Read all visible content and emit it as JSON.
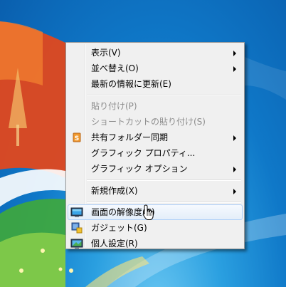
{
  "context_menu": {
    "items": [
      {
        "label": "表示(V)",
        "has_submenu": true,
        "disabled": false
      },
      {
        "label": "並べ替え(O)",
        "has_submenu": true,
        "disabled": false
      },
      {
        "label": "最新の情報に更新(E)",
        "has_submenu": false,
        "disabled": false
      },
      {
        "label": "貼り付け(P)",
        "has_submenu": false,
        "disabled": true
      },
      {
        "label": "ショートカットの貼り付け(S)",
        "has_submenu": false,
        "disabled": true
      },
      {
        "label": "共有フォルダー同期",
        "has_submenu": true,
        "disabled": false,
        "icon": "sync-folder-icon"
      },
      {
        "label": "グラフィック プロパティ...",
        "has_submenu": false,
        "disabled": false
      },
      {
        "label": "グラフィック オプション",
        "has_submenu": true,
        "disabled": false
      },
      {
        "label": "新規作成(X)",
        "has_submenu": true,
        "disabled": false
      },
      {
        "label": "画面の解像度(C)",
        "has_submenu": false,
        "disabled": false,
        "icon": "display-resolution-icon",
        "highlighted": true
      },
      {
        "label": "ガジェット(G)",
        "has_submenu": false,
        "disabled": false,
        "icon": "gadget-icon"
      },
      {
        "label": "個人設定(R)",
        "has_submenu": false,
        "disabled": false,
        "icon": "personalize-icon"
      }
    ]
  },
  "colors": {
    "menu_background": "#f0f0f0",
    "highlight_border": "#aecff7",
    "disabled_text": "#8d8d8d",
    "wallpaper_blue": "#0f78c8"
  }
}
